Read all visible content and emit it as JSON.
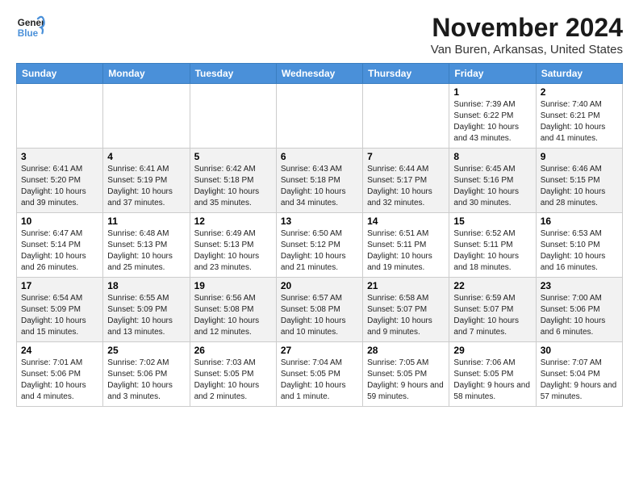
{
  "logo": {
    "line1": "General",
    "line2": "Blue"
  },
  "title": "November 2024",
  "location": "Van Buren, Arkansas, United States",
  "days_of_week": [
    "Sunday",
    "Monday",
    "Tuesday",
    "Wednesday",
    "Thursday",
    "Friday",
    "Saturday"
  ],
  "weeks": [
    [
      {
        "day": "",
        "info": ""
      },
      {
        "day": "",
        "info": ""
      },
      {
        "day": "",
        "info": ""
      },
      {
        "day": "",
        "info": ""
      },
      {
        "day": "",
        "info": ""
      },
      {
        "day": "1",
        "info": "Sunrise: 7:39 AM\nSunset: 6:22 PM\nDaylight: 10 hours and 43 minutes."
      },
      {
        "day": "2",
        "info": "Sunrise: 7:40 AM\nSunset: 6:21 PM\nDaylight: 10 hours and 41 minutes."
      }
    ],
    [
      {
        "day": "3",
        "info": "Sunrise: 6:41 AM\nSunset: 5:20 PM\nDaylight: 10 hours and 39 minutes."
      },
      {
        "day": "4",
        "info": "Sunrise: 6:41 AM\nSunset: 5:19 PM\nDaylight: 10 hours and 37 minutes."
      },
      {
        "day": "5",
        "info": "Sunrise: 6:42 AM\nSunset: 5:18 PM\nDaylight: 10 hours and 35 minutes."
      },
      {
        "day": "6",
        "info": "Sunrise: 6:43 AM\nSunset: 5:18 PM\nDaylight: 10 hours and 34 minutes."
      },
      {
        "day": "7",
        "info": "Sunrise: 6:44 AM\nSunset: 5:17 PM\nDaylight: 10 hours and 32 minutes."
      },
      {
        "day": "8",
        "info": "Sunrise: 6:45 AM\nSunset: 5:16 PM\nDaylight: 10 hours and 30 minutes."
      },
      {
        "day": "9",
        "info": "Sunrise: 6:46 AM\nSunset: 5:15 PM\nDaylight: 10 hours and 28 minutes."
      }
    ],
    [
      {
        "day": "10",
        "info": "Sunrise: 6:47 AM\nSunset: 5:14 PM\nDaylight: 10 hours and 26 minutes."
      },
      {
        "day": "11",
        "info": "Sunrise: 6:48 AM\nSunset: 5:13 PM\nDaylight: 10 hours and 25 minutes."
      },
      {
        "day": "12",
        "info": "Sunrise: 6:49 AM\nSunset: 5:13 PM\nDaylight: 10 hours and 23 minutes."
      },
      {
        "day": "13",
        "info": "Sunrise: 6:50 AM\nSunset: 5:12 PM\nDaylight: 10 hours and 21 minutes."
      },
      {
        "day": "14",
        "info": "Sunrise: 6:51 AM\nSunset: 5:11 PM\nDaylight: 10 hours and 19 minutes."
      },
      {
        "day": "15",
        "info": "Sunrise: 6:52 AM\nSunset: 5:11 PM\nDaylight: 10 hours and 18 minutes."
      },
      {
        "day": "16",
        "info": "Sunrise: 6:53 AM\nSunset: 5:10 PM\nDaylight: 10 hours and 16 minutes."
      }
    ],
    [
      {
        "day": "17",
        "info": "Sunrise: 6:54 AM\nSunset: 5:09 PM\nDaylight: 10 hours and 15 minutes."
      },
      {
        "day": "18",
        "info": "Sunrise: 6:55 AM\nSunset: 5:09 PM\nDaylight: 10 hours and 13 minutes."
      },
      {
        "day": "19",
        "info": "Sunrise: 6:56 AM\nSunset: 5:08 PM\nDaylight: 10 hours and 12 minutes."
      },
      {
        "day": "20",
        "info": "Sunrise: 6:57 AM\nSunset: 5:08 PM\nDaylight: 10 hours and 10 minutes."
      },
      {
        "day": "21",
        "info": "Sunrise: 6:58 AM\nSunset: 5:07 PM\nDaylight: 10 hours and 9 minutes."
      },
      {
        "day": "22",
        "info": "Sunrise: 6:59 AM\nSunset: 5:07 PM\nDaylight: 10 hours and 7 minutes."
      },
      {
        "day": "23",
        "info": "Sunrise: 7:00 AM\nSunset: 5:06 PM\nDaylight: 10 hours and 6 minutes."
      }
    ],
    [
      {
        "day": "24",
        "info": "Sunrise: 7:01 AM\nSunset: 5:06 PM\nDaylight: 10 hours and 4 minutes."
      },
      {
        "day": "25",
        "info": "Sunrise: 7:02 AM\nSunset: 5:06 PM\nDaylight: 10 hours and 3 minutes."
      },
      {
        "day": "26",
        "info": "Sunrise: 7:03 AM\nSunset: 5:05 PM\nDaylight: 10 hours and 2 minutes."
      },
      {
        "day": "27",
        "info": "Sunrise: 7:04 AM\nSunset: 5:05 PM\nDaylight: 10 hours and 1 minute."
      },
      {
        "day": "28",
        "info": "Sunrise: 7:05 AM\nSunset: 5:05 PM\nDaylight: 9 hours and 59 minutes."
      },
      {
        "day": "29",
        "info": "Sunrise: 7:06 AM\nSunset: 5:05 PM\nDaylight: 9 hours and 58 minutes."
      },
      {
        "day": "30",
        "info": "Sunrise: 7:07 AM\nSunset: 5:04 PM\nDaylight: 9 hours and 57 minutes."
      }
    ]
  ]
}
